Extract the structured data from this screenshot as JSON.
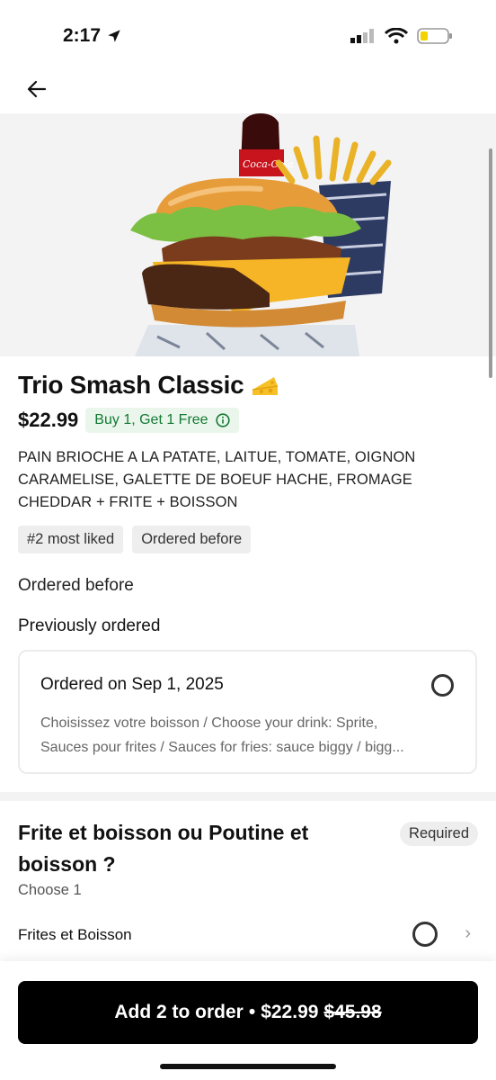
{
  "status_bar": {
    "time": "2:17"
  },
  "item": {
    "title": "Trio Smash Classic",
    "price": "$22.99",
    "promo": "Buy 1, Get 1 Free",
    "description": "PAIN BRIOCHE A LA PATATE, LAITUE, TOMATE, OIGNON CARAMELISE, GALETTE DE BOEUF HACHE, FROMAGE CHEDDAR + FRITE + BOISSON",
    "tags": [
      "#2 most liked",
      "Ordered before"
    ]
  },
  "ordered_before_label": "Ordered before",
  "previously_ordered": {
    "title": "Previously ordered",
    "card": {
      "date": "Ordered on Sep 1, 2025",
      "line1": "Choisissez votre boisson / Choose your drink: Sprite,",
      "line2": "Sauces pour frites / Sauces for fries: sauce biggy /  bigg..."
    }
  },
  "option_group": {
    "title": "Frite et boisson ou Poutine et boisson ?",
    "badge": "Required",
    "subtitle": "Choose 1",
    "options": [
      {
        "label": "Frites et Boisson"
      }
    ]
  },
  "order_button": {
    "label": "Add 2 to order",
    "separator": "•",
    "price": "$22.99",
    "original_price": "$45.98"
  },
  "icons": [
    "location-arrow-icon",
    "signal-icon",
    "wifi-icon",
    "battery-icon",
    "back-arrow-icon",
    "cheese-icon",
    "info-icon",
    "chevron-right-icon"
  ],
  "colors": {
    "accent_green": "#137a33",
    "promo_bg": "#eaf6ec",
    "button_bg": "#000000"
  }
}
